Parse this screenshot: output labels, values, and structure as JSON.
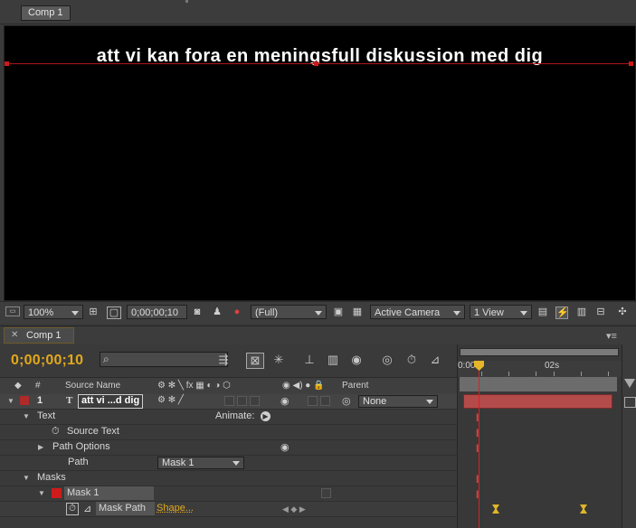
{
  "composition_panel": {
    "tab_label": "Comp 1",
    "caption_text": "att vi kan fora en meningsfull diskussion med dig",
    "toolbar": {
      "zoom": "100%",
      "timecode": "0;00;00;10",
      "resolution": "(Full)",
      "camera": "Active Camera",
      "views": "1 View"
    }
  },
  "timeline": {
    "tab_label": "Comp 1",
    "timecode": "0;00;00;10",
    "search_placeholder": "",
    "columns": {
      "number": "#",
      "source_name": "Source Name",
      "parent": "Parent"
    },
    "ruler_labels": {
      "start": "0:00",
      "mark": "02s"
    },
    "layer": {
      "number": "1",
      "name": "att vi ...d dig",
      "parent": "None",
      "label_color": "#b02a2a"
    },
    "rows": {
      "text": "Text",
      "animate": "Animate:",
      "source_text": "Source Text",
      "path_options": "Path Options",
      "path": "Path",
      "path_value": "Mask 1",
      "masks": "Masks",
      "mask1": "Mask 1",
      "mask_path": "Mask Path",
      "mask_path_value": "Shape..."
    }
  },
  "colors": {
    "accent_timecode": "#e2a81b",
    "cti_red": "#d52222",
    "layer_bar": "#b44b4b"
  }
}
